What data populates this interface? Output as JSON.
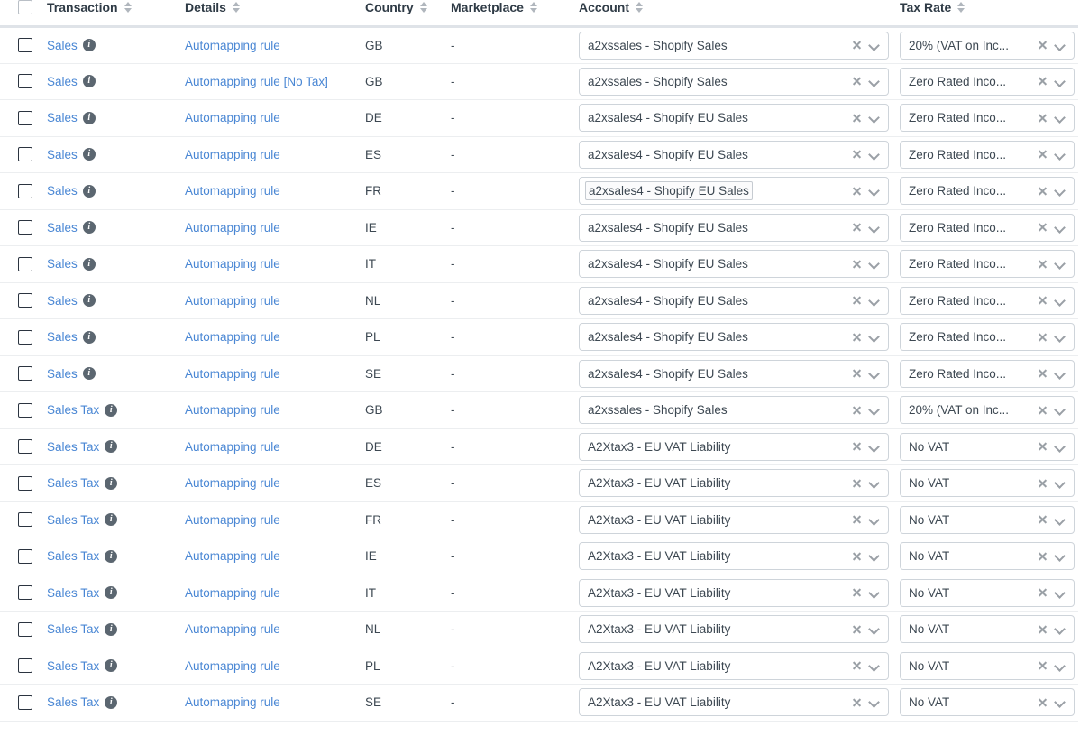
{
  "table": {
    "columns": [
      {
        "key": "checkbox",
        "label": "",
        "sortable": false
      },
      {
        "key": "transaction",
        "label": "Transaction",
        "sortable": true
      },
      {
        "key": "details",
        "label": "Details",
        "sortable": true
      },
      {
        "key": "country",
        "label": "Country",
        "sortable": true
      },
      {
        "key": "marketplace",
        "label": "Marketplace",
        "sortable": true
      },
      {
        "key": "account",
        "label": "Account",
        "sortable": true
      },
      {
        "key": "tax_rate",
        "label": "Tax Rate",
        "sortable": true
      }
    ],
    "select_all_checked": false,
    "icons": {
      "sort": "sort-icon",
      "info": "info-icon",
      "clear": "clear-icon",
      "chevron": "chevron-down-icon"
    },
    "colors": {
      "link": "#4a87d4",
      "text": "#3d4852",
      "header_text": "#2f3b46",
      "border": "#eceef0",
      "header_border": "#dfe3e8",
      "select_border": "#ced4da",
      "info_badge": "#5b6670",
      "icon_gray": "#9aa0a6",
      "sort_gray": "#b0b6bd"
    },
    "rows": [
      {
        "checked": false,
        "transaction": "Sales",
        "info": "i",
        "details": "Automapping rule",
        "country": "GB",
        "marketplace": "-",
        "account": "a2xssales - Shopify Sales",
        "account_focused": false,
        "tax_rate": "20% (VAT on Inc..."
      },
      {
        "checked": false,
        "transaction": "Sales",
        "info": "i",
        "details": "Automapping rule [No Tax]",
        "country": "GB",
        "marketplace": "-",
        "account": "a2xssales - Shopify Sales",
        "account_focused": false,
        "tax_rate": "Zero Rated Inco..."
      },
      {
        "checked": false,
        "transaction": "Sales",
        "info": "i",
        "details": "Automapping rule",
        "country": "DE",
        "marketplace": "-",
        "account": "a2xsales4 - Shopify EU Sales",
        "account_focused": false,
        "tax_rate": "Zero Rated Inco..."
      },
      {
        "checked": false,
        "transaction": "Sales",
        "info": "i",
        "details": "Automapping rule",
        "country": "ES",
        "marketplace": "-",
        "account": "a2xsales4 - Shopify EU Sales",
        "account_focused": false,
        "tax_rate": "Zero Rated Inco..."
      },
      {
        "checked": false,
        "transaction": "Sales",
        "info": "i",
        "details": "Automapping rule",
        "country": "FR",
        "marketplace": "-",
        "account": "a2xsales4 - Shopify EU Sales",
        "account_focused": true,
        "tax_rate": "Zero Rated Inco..."
      },
      {
        "checked": false,
        "transaction": "Sales",
        "info": "i",
        "details": "Automapping rule",
        "country": "IE",
        "marketplace": "-",
        "account": "a2xsales4 - Shopify EU Sales",
        "account_focused": false,
        "tax_rate": "Zero Rated Inco..."
      },
      {
        "checked": false,
        "transaction": "Sales",
        "info": "i",
        "details": "Automapping rule",
        "country": "IT",
        "marketplace": "-",
        "account": "a2xsales4 - Shopify EU Sales",
        "account_focused": false,
        "tax_rate": "Zero Rated Inco..."
      },
      {
        "checked": false,
        "transaction": "Sales",
        "info": "i",
        "details": "Automapping rule",
        "country": "NL",
        "marketplace": "-",
        "account": "a2xsales4 - Shopify EU Sales",
        "account_focused": false,
        "tax_rate": "Zero Rated Inco..."
      },
      {
        "checked": false,
        "transaction": "Sales",
        "info": "i",
        "details": "Automapping rule",
        "country": "PL",
        "marketplace": "-",
        "account": "a2xsales4 - Shopify EU Sales",
        "account_focused": false,
        "tax_rate": "Zero Rated Inco..."
      },
      {
        "checked": false,
        "transaction": "Sales",
        "info": "i",
        "details": "Automapping rule",
        "country": "SE",
        "marketplace": "-",
        "account": "a2xsales4 - Shopify EU Sales",
        "account_focused": false,
        "tax_rate": "Zero Rated Inco..."
      },
      {
        "checked": false,
        "transaction": "Sales Tax",
        "info": "i",
        "details": "Automapping rule",
        "country": "GB",
        "marketplace": "-",
        "account": "a2xssales - Shopify Sales",
        "account_focused": false,
        "tax_rate": "20% (VAT on Inc..."
      },
      {
        "checked": false,
        "transaction": "Sales Tax",
        "info": "i",
        "details": "Automapping rule",
        "country": "DE",
        "marketplace": "-",
        "account": "A2Xtax3 - EU VAT Liability",
        "account_focused": false,
        "tax_rate": "No VAT"
      },
      {
        "checked": false,
        "transaction": "Sales Tax",
        "info": "i",
        "details": "Automapping rule",
        "country": "ES",
        "marketplace": "-",
        "account": "A2Xtax3 - EU VAT Liability",
        "account_focused": false,
        "tax_rate": "No VAT"
      },
      {
        "checked": false,
        "transaction": "Sales Tax",
        "info": "i",
        "details": "Automapping rule",
        "country": "FR",
        "marketplace": "-",
        "account": "A2Xtax3 - EU VAT Liability",
        "account_focused": false,
        "tax_rate": "No VAT"
      },
      {
        "checked": false,
        "transaction": "Sales Tax",
        "info": "i",
        "details": "Automapping rule",
        "country": "IE",
        "marketplace": "-",
        "account": "A2Xtax3 - EU VAT Liability",
        "account_focused": false,
        "tax_rate": "No VAT"
      },
      {
        "checked": false,
        "transaction": "Sales Tax",
        "info": "i",
        "details": "Automapping rule",
        "country": "IT",
        "marketplace": "-",
        "account": "A2Xtax3 - EU VAT Liability",
        "account_focused": false,
        "tax_rate": "No VAT"
      },
      {
        "checked": false,
        "transaction": "Sales Tax",
        "info": "i",
        "details": "Automapping rule",
        "country": "NL",
        "marketplace": "-",
        "account": "A2Xtax3 - EU VAT Liability",
        "account_focused": false,
        "tax_rate": "No VAT"
      },
      {
        "checked": false,
        "transaction": "Sales Tax",
        "info": "i",
        "details": "Automapping rule",
        "country": "PL",
        "marketplace": "-",
        "account": "A2Xtax3 - EU VAT Liability",
        "account_focused": false,
        "tax_rate": "No VAT"
      },
      {
        "checked": false,
        "transaction": "Sales Tax",
        "info": "i",
        "details": "Automapping rule",
        "country": "SE",
        "marketplace": "-",
        "account": "A2Xtax3 - EU VAT Liability",
        "account_focused": false,
        "tax_rate": "No VAT"
      }
    ]
  }
}
